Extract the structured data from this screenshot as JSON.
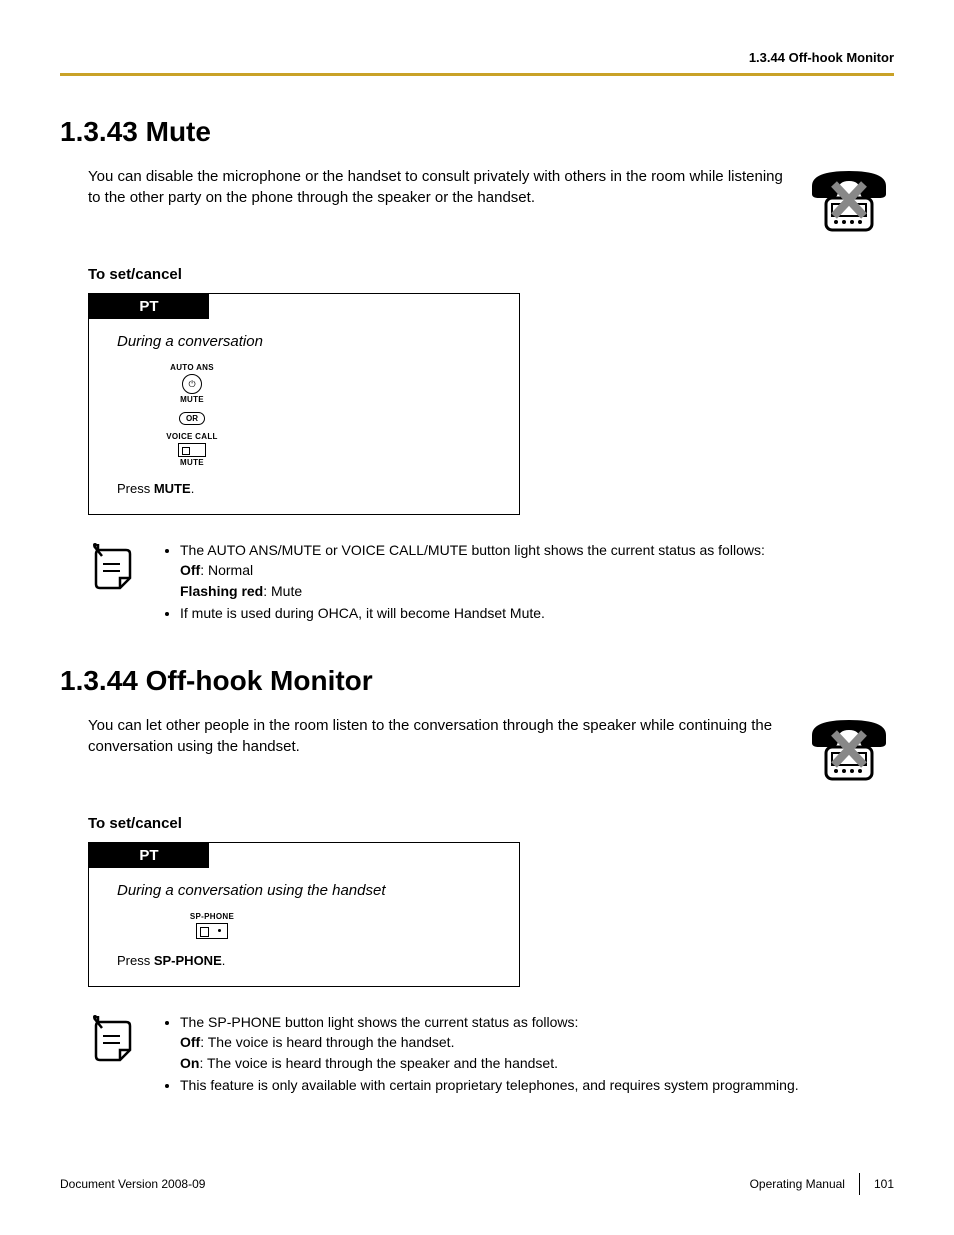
{
  "header": {
    "breadcrumb": "1.3.44 Off-hook Monitor"
  },
  "section1": {
    "heading": "1.3.43  Mute",
    "intro": "You can disable the microphone or the handset to consult privately with others in the room while listening to the other party on the phone through the speaker or the handset.",
    "subhead": "To set/cancel",
    "box": {
      "tab": "PT",
      "context": "During a conversation",
      "btn1_top": "AUTO ANS",
      "btn1_bottom": "MUTE",
      "or": "OR",
      "btn2_top": "VOICE CALL",
      "btn2_bottom": "MUTE",
      "press_pre": "Press ",
      "press_bold": "MUTE",
      "press_post": "."
    },
    "notes": {
      "b1_line1": "The AUTO ANS/MUTE or VOICE CALL/MUTE button light shows the current status as follows:",
      "b1_off_label": "Off",
      "b1_off_text": ": Normal",
      "b1_flash_label": "Flashing red",
      "b1_flash_text": ": Mute",
      "b2": "If mute is used during OHCA, it will become Handset Mute."
    }
  },
  "section2": {
    "heading": "1.3.44  Off-hook Monitor",
    "intro": "You can let other people in the room listen to the conversation through the speaker while continuing the conversation using the handset.",
    "subhead": "To set/cancel",
    "box": {
      "tab": "PT",
      "context": "During a conversation using the handset",
      "btn_top": "SP-PHONE",
      "press_pre": "Press ",
      "press_bold": "SP-PHONE",
      "press_post": "."
    },
    "notes": {
      "b1_line1": "The SP-PHONE button light shows the current status as follows:",
      "b1_off_label": "Off",
      "b1_off_text": ": The voice is heard through the handset.",
      "b1_on_label": "On",
      "b1_on_text": ": The voice is heard through the speaker and the handset.",
      "b2": "This feature is only available with certain proprietary telephones, and requires system programming."
    }
  },
  "footer": {
    "left": "Document Version  2008-09",
    "right_label": "Operating Manual",
    "page": "101"
  }
}
